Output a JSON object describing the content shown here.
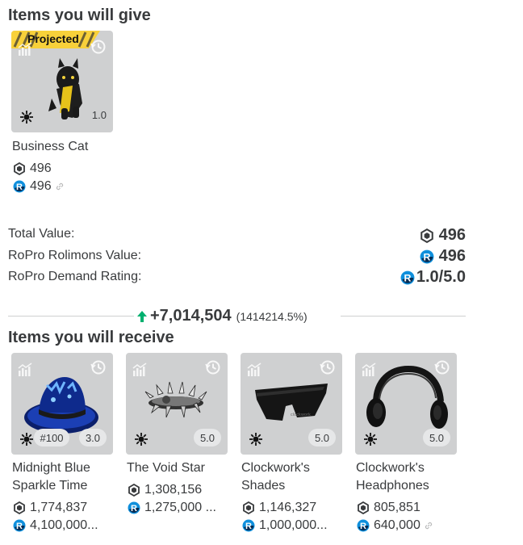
{
  "give": {
    "title": "Items you will give",
    "items": [
      {
        "name": "Business Cat",
        "badge": "Projected",
        "demand": "1.0",
        "robux_value": "496",
        "rolimons_value": "496"
      }
    ],
    "summary": {
      "total_label": "Total Value:",
      "total_value": "496",
      "rolimons_label": "RoPro Rolimons Value:",
      "rolimons_value": "496",
      "demand_label": "RoPro Demand Rating:",
      "demand_value": "1.0/5.0"
    }
  },
  "difference": {
    "amount": "+7,014,504",
    "percent": "(1414214.5%)"
  },
  "receive": {
    "title": "Items you will receive",
    "items": [
      {
        "name_line1": "Midnight Blue",
        "name_line2": "Sparkle Time",
        "rank": "#100",
        "demand": "3.0",
        "robux_value": "1,774,837",
        "rolimons_value": "4,100,000..."
      },
      {
        "name_line1": "The Void Star",
        "name_line2": "",
        "demand": "5.0",
        "robux_value": "1,308,156",
        "rolimons_value": "1,275,000 ..."
      },
      {
        "name_line1": "Clockwork's",
        "name_line2": "Shades",
        "demand": "5.0",
        "robux_value": "1,146,327",
        "rolimons_value": "1,000,000..."
      },
      {
        "name_line1": "Clockwork's",
        "name_line2": "Headphones",
        "demand": "5.0",
        "robux_value": "805,851",
        "rolimons_value": "640,000"
      }
    ]
  },
  "colors": {
    "card_bg": "#cfd0d1",
    "text": "#393b3d",
    "up_arrow": "#00b06f",
    "projected_yellow": "#f8d13a",
    "rolimons_blue": "#0f8fdc"
  }
}
